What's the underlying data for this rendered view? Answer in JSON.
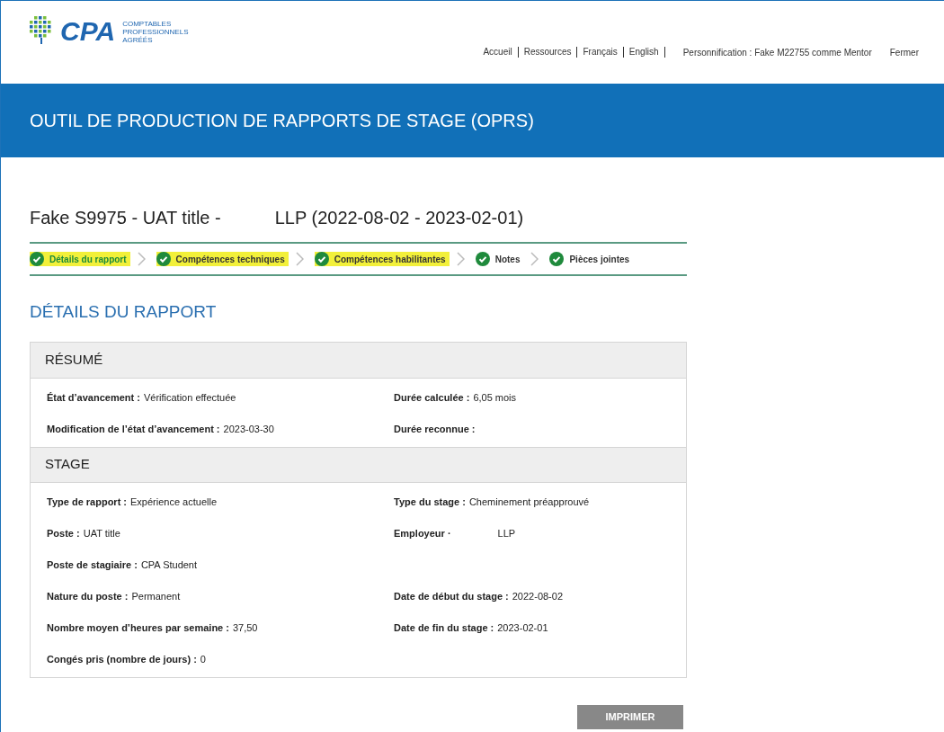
{
  "logo": {
    "mark": "CPA",
    "lines": [
      "COMPTABLES",
      "PROFESSIONNELS",
      "AGRÉÉS"
    ]
  },
  "nav": [
    "Accueil",
    "Ressources",
    "Français",
    "English"
  ],
  "impersonation": "Personnification : Fake M22755 comme Mentor",
  "close_link": "Fermer",
  "banner_title": "OUTIL DE PRODUCTION DE RAPPORTS DE STAGE (OPRS)",
  "report_title": {
    "before": "Fake S9975 - UAT title -",
    "after": "LLP (2022-08-02 - 2023-02-01)"
  },
  "steps": [
    {
      "label": "Détails du rapport",
      "selected": true,
      "highlighted": true,
      "done": true
    },
    {
      "label": "Compétences techniques",
      "selected": false,
      "highlighted": true,
      "done": true
    },
    {
      "label": "Compétences habilitantes",
      "selected": false,
      "highlighted": true,
      "done": true
    },
    {
      "label": "Notes",
      "selected": false,
      "highlighted": false,
      "done": true
    },
    {
      "label": "Pièces jointes",
      "selected": false,
      "highlighted": false,
      "done": true
    }
  ],
  "section_title": "DÉTAILS DU RAPPORT",
  "panels": [
    {
      "title": "RÉSUMÉ",
      "rows": [
        {
          "left": {
            "label": "État d’avancement :",
            "value": "Vérification effectuée"
          },
          "right": {
            "label": "Durée calculée :",
            "value": "6,05 mois"
          }
        },
        {
          "left": {
            "label": "Modification de l’état d’avancement :",
            "value": "2023-03-30"
          },
          "right": {
            "label": "Durée reconnue :"
          }
        }
      ]
    },
    {
      "title": "STAGE",
      "rows": [
        {
          "left": {
            "label": "Type de rapport :",
            "value": "Expérience actuelle"
          },
          "right": {
            "label": "Type du stage :",
            "value": "Cheminement préapprouvé"
          }
        },
        {
          "left": {
            "label": "Poste :",
            "value": "UAT title"
          },
          "right": {
            "label": "Employeur ·",
            "value": "LLP"
          }
        },
        {
          "left": {
            "label": "Poste de stagiaire :",
            "value": "CPA Student"
          }
        },
        {
          "left": {
            "label": "Nature du poste :",
            "value": "Permanent"
          },
          "right": {
            "label": "Date de début du stage :",
            "value": "2022-08-02"
          }
        },
        {
          "left": {
            "label": "Nombre moyen d’heures par semaine :",
            "value": "37,50"
          },
          "right": {
            "label": "Date de fin du stage :",
            "value": "2023-02-01"
          }
        },
        {
          "left": {
            "label": "Congés pris (nombre de jours) :",
            "value": "0"
          }
        }
      ]
    }
  ],
  "print_button": "IMPRIMER"
}
